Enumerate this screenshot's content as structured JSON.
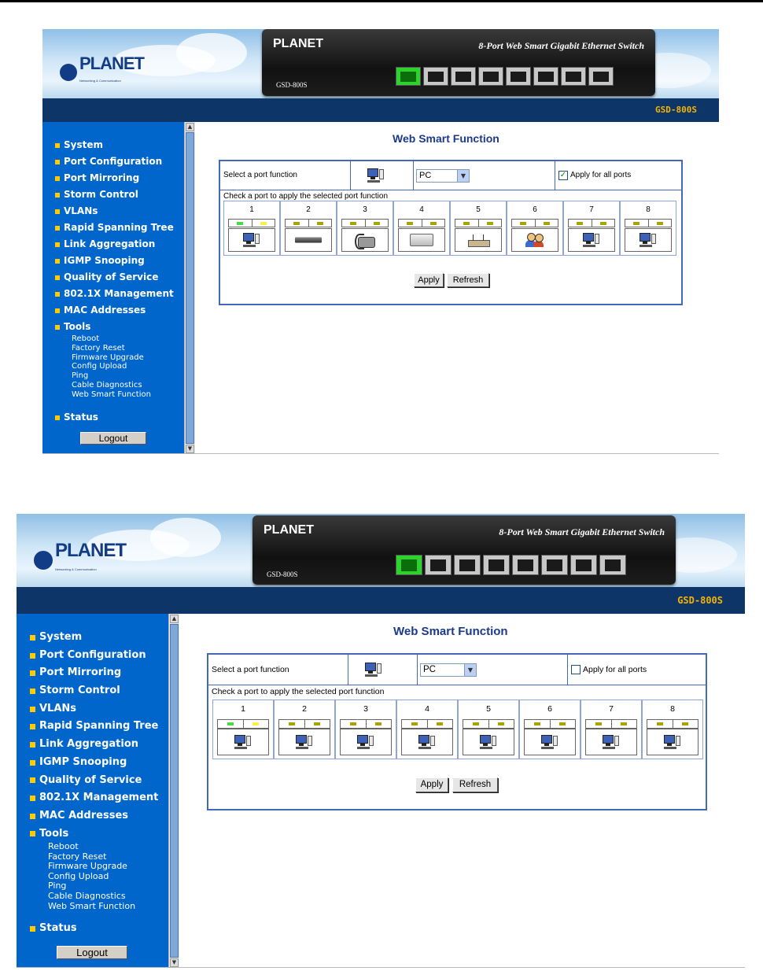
{
  "brand": {
    "logo_word": "PLANET",
    "logo_sub": "Networking & Communication",
    "device_title": "8-Port Web Smart Gigabit Ethernet Switch",
    "model": "GSD-800S"
  },
  "sidebar": {
    "items": [
      {
        "label": "System"
      },
      {
        "label": "Port Configuration"
      },
      {
        "label": "Port Mirroring"
      },
      {
        "label": "Storm Control"
      },
      {
        "label": "VLANs"
      },
      {
        "label": "Rapid Spanning Tree"
      },
      {
        "label": "Link Aggregation"
      },
      {
        "label": "IGMP Snooping"
      },
      {
        "label": "Quality of Service"
      },
      {
        "label": "802.1X Management"
      },
      {
        "label": "MAC Addresses"
      },
      {
        "label": "Tools"
      }
    ],
    "tools_sub": [
      "Reboot",
      "Factory Reset",
      "Firmware Upgrade",
      "Config Upload",
      "Ping",
      "Cable Diagnostics",
      "Web Smart Function"
    ],
    "status": "Status",
    "logout": "Logout"
  },
  "page": {
    "title": "Web Smart Function",
    "select_label": "Select a port function",
    "apply_all": "Apply for all ports",
    "check_hint": "Check a port to apply the selected port function",
    "apply": "Apply",
    "refresh": "Refresh",
    "port_numbers": [
      "1",
      "2",
      "3",
      "4",
      "5",
      "6",
      "7",
      "8"
    ]
  },
  "screens": [
    {
      "selected_function": "PC",
      "apply_all_checked": true,
      "port_icons": [
        "pc-icon",
        "switch-icon",
        "ip-phone-icon",
        "printer-icon",
        "router-icon",
        "users-icon",
        "pc-icon",
        "pc-icon"
      ]
    },
    {
      "selected_function": "PC",
      "apply_all_checked": false,
      "port_icons": [
        "pc-icon",
        "pc-icon",
        "pc-icon",
        "pc-icon",
        "pc-icon",
        "pc-icon",
        "pc-icon",
        "pc-icon"
      ]
    }
  ],
  "colors": {
    "sidebar": "#0066cc",
    "header_bar": "#0e3568",
    "model_text": "#f4b400",
    "title": "#1b3a8c",
    "panel_border": "#4369b8"
  }
}
